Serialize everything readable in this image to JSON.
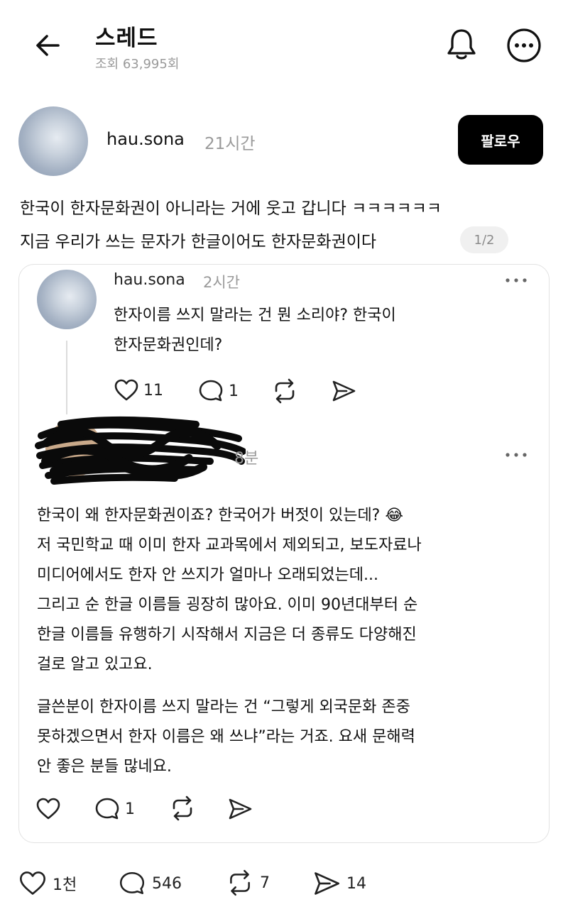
{
  "header": {
    "title": "스레드",
    "views": "조회 63,995회",
    "back_icon": "arrow-left-icon",
    "bell_icon": "bell-icon",
    "more_icon": "more-circle-icon"
  },
  "post": {
    "author": "hau.sona",
    "time": "21시간",
    "follow_label": "팔로우",
    "lines": [
      "한국이 한자문화권이 아니라는 거에 웃고 갑니다 ㅋㅋㅋㅋㅋㅋ",
      "지금 우리가 쓰는 문자가 한글이어도 한자문화권이다"
    ],
    "page_indicator": "1/2"
  },
  "quoted": {
    "author": "hau.sona",
    "time": "2시간",
    "lines": [
      "한자이름 쓰지 말라는 건 뭔 소리야? 한국이",
      "한자문화권인데?"
    ],
    "likes": "11",
    "replies": "1"
  },
  "reply": {
    "time": "8분",
    "lines": [
      "한국이 왜 한자문화권이죠? 한국어가 버젓이 있는데? 😂",
      "저 국민학교 때 이미 한자 교과목에서 제외되고, 보도자료나",
      "미디어에서도 한자 안 쓰지가 얼마나 오래되었는데...",
      "그리고 순 한글 이름들 굉장히 많아요. 이미 90년대부터 순",
      "한글 이름들 유행하기 시작해서 지금은 더 종류도 다양해진",
      "걸로 알고 있고요.",
      "글쓴분이 한자이름 쓰지 말라는 건 “그렇게 외국문화 존중",
      "못하겠으면서 한자 이름은 왜 쓰냐”라는 거죠. 요새 문해력",
      "안 좋은 분들 많네요."
    ],
    "replies": "1"
  },
  "stats": {
    "likes": "1천",
    "replies": "546",
    "reposts": "7",
    "shares": "14"
  },
  "colors": {
    "text": "#111111",
    "muted": "#9a9a9a",
    "follow_bg": "#000000",
    "border": "#e2e2e2"
  }
}
